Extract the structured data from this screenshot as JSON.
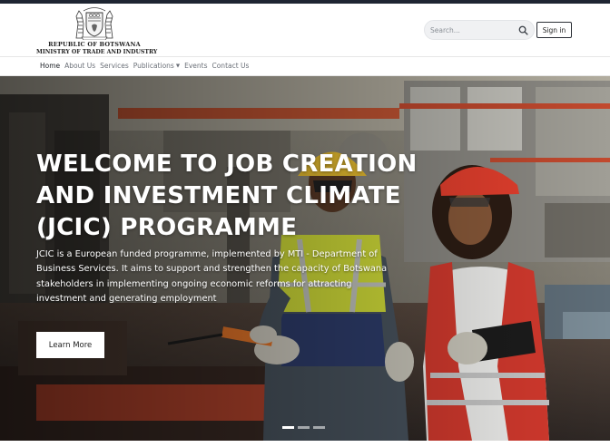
{
  "header": {
    "logo_line1": "REPUBLIC OF BOTSWANA",
    "logo_line2": "MINISTRY OF TRADE AND INDUSTRY",
    "search_placeholder": "Search...",
    "search_icon": "search-icon",
    "signin_label": "Sign in"
  },
  "nav": {
    "items": [
      {
        "label": "Home",
        "active": true
      },
      {
        "label": "About Us"
      },
      {
        "label": "Services"
      },
      {
        "label": "Publications",
        "dropdown": true
      },
      {
        "label": "Events"
      },
      {
        "label": "Contact Us"
      }
    ]
  },
  "hero": {
    "title": "WELCOME TO JOB CREATION AND INVESTMENT CLIMATE (JCIC) PROGRAMME",
    "text": "JCIC  is a European funded programme, implemented by MTI - Department of Business Services. It aims to support and strengthen the capacity of Botswana stakeholders in implementing ongoing economic reforms for attracting investment and generating employment",
    "button_label": "Learn More",
    "slide_count": 3,
    "active_slide": 1
  },
  "colors": {
    "topbar": "#1e2532",
    "helmet": "#e8402e",
    "vest_yellow": "#d7e33a",
    "vest_red": "#d63a2e"
  }
}
